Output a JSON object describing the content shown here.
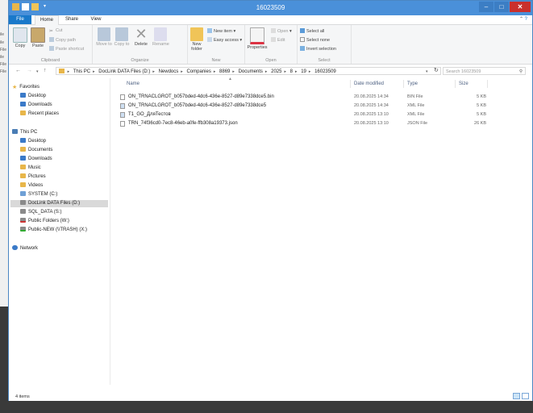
{
  "window": {
    "title": "16023509"
  },
  "background_snippets": [
    "ile",
    "ile",
    "File",
    "ile",
    "File",
    "File"
  ],
  "ribbon_tabs": [
    "File",
    "Home",
    "Share",
    "View"
  ],
  "ribbon": {
    "clipboard": {
      "label": "Clipboard",
      "copy": "Copy",
      "paste": "Paste",
      "cut": "Cut",
      "copy_path": "Copy path",
      "paste_shortcut": "Paste shortcut"
    },
    "organize": {
      "label": "Organize",
      "move_to": "Move to",
      "copy_to": "Copy to",
      "delete": "Delete",
      "rename": "Rename"
    },
    "new": {
      "label": "New",
      "new_folder": "New folder",
      "new_item": "New item",
      "easy_access": "Easy access"
    },
    "open": {
      "label": "Open",
      "properties": "Properties",
      "open": "Open",
      "edit": "Edit"
    },
    "select": {
      "label": "Select",
      "select_all": "Select all",
      "select_none": "Select none",
      "invert_selection": "Invert selection"
    }
  },
  "address": {
    "crumbs": [
      "This PC",
      "DocLink DATA Files (D:)",
      "Newdocs",
      "Companies",
      "8869",
      "Documents",
      "2025",
      "8",
      "19",
      "16023509"
    ],
    "search_placeholder": "Search 16023509"
  },
  "nav": {
    "favorites": "Favorites",
    "favorites_items": [
      "Desktop",
      "Downloads",
      "Recent places"
    ],
    "this_pc": "This PC",
    "pc_items": [
      "Desktop",
      "Documents",
      "Downloads",
      "Music",
      "Pictures",
      "Videos",
      "SYSTEM (C:)",
      "DocLink DATA Files (D:)",
      "SQL_DATA (S:)",
      "Public Folders (W:)",
      "Public-NEW (\\\\TRASH) (X:)"
    ],
    "network": "Network"
  },
  "columns": {
    "name": "Name",
    "date": "Date modified",
    "type": "Type",
    "size": "Size"
  },
  "files": [
    {
      "name": "ON_TRNACLGROT_b057bded-4dc6-436e-8527-d89e7338dce5.bin",
      "date": "20.08.2025 14:34",
      "type": "BIN File",
      "size": "5 KB"
    },
    {
      "name": "ON_TRNACLGROT_b057bded-4dc6-436e-8527-d89e7338dce5",
      "date": "20.08.2025 14:34",
      "type": "XML File",
      "size": "5 KB"
    },
    {
      "name": "T1_GO_ДляТестов",
      "date": "20.08.2025 13:10",
      "type": "XML File",
      "size": "5 KB"
    },
    {
      "name": "TRN_74f36cd0-7ec8-46eb-a0fe-ffb308a19373.json",
      "date": "20.08.2025 13:10",
      "type": "JSON File",
      "size": "26 KB"
    }
  ],
  "status": {
    "item_count": "4 items"
  }
}
